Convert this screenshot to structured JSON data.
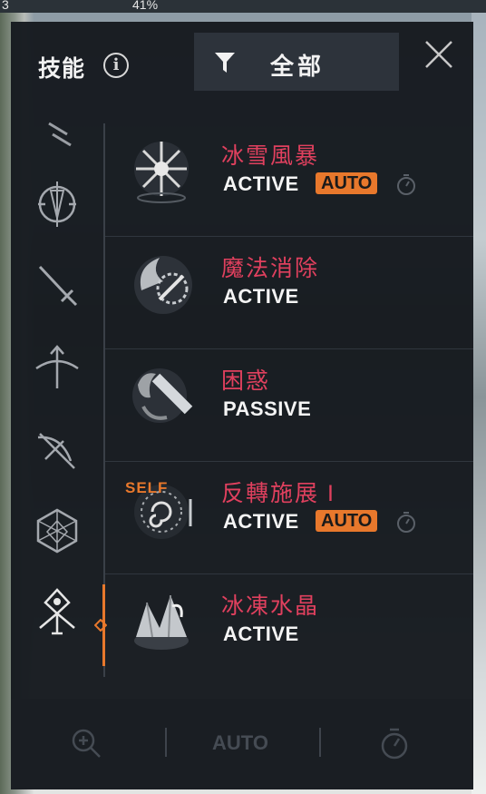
{
  "status": {
    "left": "3",
    "battery": "41%"
  },
  "header": {
    "title": "技能",
    "info_icon": "info-icon",
    "filter_label": "全部",
    "filter_icon": "filter-icon",
    "close_icon": "close-icon"
  },
  "categories": [
    {
      "name": "claw-icon",
      "selected": false
    },
    {
      "name": "shield-sword-icon",
      "selected": false
    },
    {
      "name": "dagger-icon",
      "selected": false
    },
    {
      "name": "bow-icon",
      "selected": false
    },
    {
      "name": "crossbow-icon",
      "selected": false
    },
    {
      "name": "orb-icon",
      "selected": false
    },
    {
      "name": "wizard-icon",
      "selected": true
    }
  ],
  "skills": [
    {
      "name": "冰雪風暴",
      "type": "ACTIVE",
      "auto": "AUTO",
      "icon": "blizzard-icon"
    },
    {
      "name": "魔法消除",
      "type": "ACTIVE",
      "icon": "dispel-icon"
    },
    {
      "name": "困惑",
      "type": "PASSIVE",
      "icon": "confusion-icon"
    },
    {
      "name": "反轉施展 I",
      "type": "ACTIVE",
      "auto": "AUTO",
      "self": "SELF",
      "icon": "reverse-cast-icon"
    },
    {
      "name": "冰凍水晶",
      "type": "ACTIVE",
      "icon": "frozen-crystal-icon"
    }
  ],
  "footer": {
    "auto_label": "AUTO",
    "zoom_icon": "zoom-icon",
    "timer_icon": "timer-icon"
  },
  "colors": {
    "accent": "#e8782c",
    "skill_name": "#e0405e",
    "panel": "#16191f"
  }
}
